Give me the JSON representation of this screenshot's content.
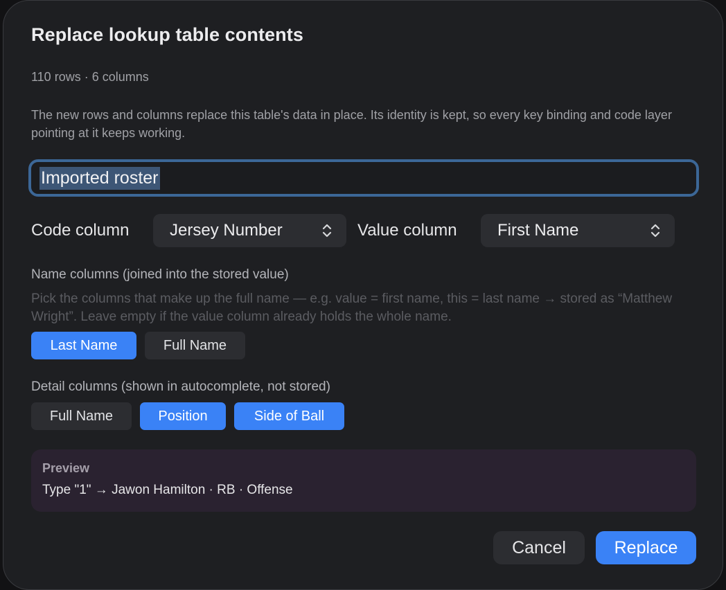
{
  "dialog": {
    "title": "Replace lookup table contents",
    "subtitle": "110 rows · 6 columns",
    "description": "The new rows and columns replace this table's data in place. Its identity is kept, so every key binding and code layer pointing at it keeps working."
  },
  "name_field": {
    "value": "Imported roster",
    "focused": true,
    "text_selected": true
  },
  "code_column": {
    "label": "Code column",
    "selected": "Jersey Number"
  },
  "value_column": {
    "label": "Value column",
    "selected": "First Name"
  },
  "name_columns": {
    "label": "Name columns (joined into the stored value)",
    "hint": "Pick the columns that make up the full name — e.g. value = first name, this = last name → stored as “Matthew Wright”. Leave empty if the value column already holds the whole name.",
    "chips": [
      {
        "label": "Last Name",
        "selected": true
      },
      {
        "label": "Full Name",
        "selected": false
      }
    ]
  },
  "detail_columns": {
    "label": "Detail columns (shown in autocomplete, not stored)",
    "chips": [
      {
        "label": "Full Name",
        "selected": false
      },
      {
        "label": "Position",
        "selected": true
      },
      {
        "label": "Side of Ball",
        "selected": true
      }
    ]
  },
  "preview": {
    "title": "Preview",
    "text": "Type \"1\" → Jawon Hamilton · RB · Offense"
  },
  "actions": {
    "cancel_label": "Cancel",
    "confirm_label": "Replace"
  },
  "colors": {
    "accent": "#3a82f6",
    "focus_ring": "#3c6797",
    "dialog_bg": "#1e1f22",
    "preview_bg": "#2a2230"
  },
  "icons": {
    "select_chevron": "chevron-up-down-icon"
  }
}
